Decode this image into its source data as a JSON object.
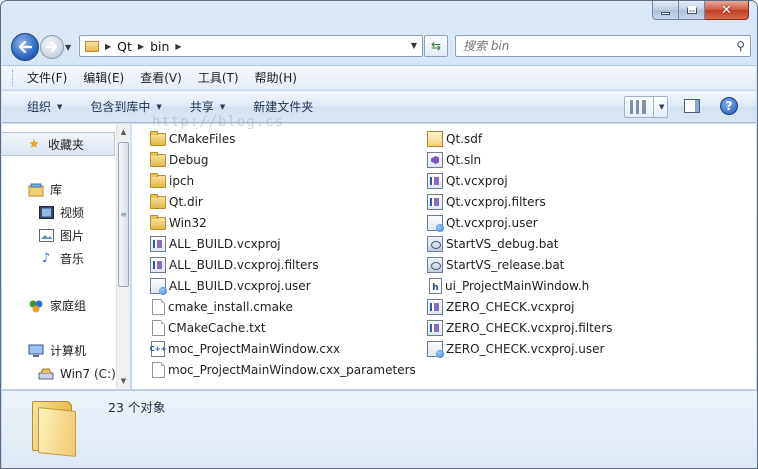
{
  "window": {
    "caption_buttons": {
      "minimize": "minimize-icon",
      "maximize": "maximize-icon",
      "close": "close-icon"
    }
  },
  "address": {
    "crumbs": [
      "Qt",
      "bin"
    ],
    "search_placeholder": "搜索 bin"
  },
  "menu": {
    "items": [
      "文件(F)",
      "编辑(E)",
      "查看(V)",
      "工具(T)",
      "帮助(H)"
    ]
  },
  "commands": {
    "organize": "组织",
    "include_in_library": "包含到库中",
    "share": "共享",
    "new_folder": "新建文件夹"
  },
  "nav": {
    "favorites": "收藏夹",
    "libraries": "库",
    "videos": "视频",
    "pictures": "图片",
    "music": "音乐",
    "homegroup": "家庭组",
    "computer": "计算机",
    "drive": "Win7 (C:)"
  },
  "files": {
    "col1": [
      {
        "name": "CMakeFiles",
        "icon": "folder"
      },
      {
        "name": "Debug",
        "icon": "folder"
      },
      {
        "name": "ipch",
        "icon": "folder"
      },
      {
        "name": "Qt.dir",
        "icon": "folder"
      },
      {
        "name": "Win32",
        "icon": "folder"
      },
      {
        "name": "ALL_BUILD.vcxproj",
        "icon": "vs"
      },
      {
        "name": "ALL_BUILD.vcxproj.filters",
        "icon": "vs"
      },
      {
        "name": "ALL_BUILD.vcxproj.user",
        "icon": "user"
      },
      {
        "name": "cmake_install.cmake",
        "icon": "doc"
      },
      {
        "name": "CMakeCache.txt",
        "icon": "doc"
      },
      {
        "name": "moc_ProjectMainWindow.cxx",
        "icon": "cpp"
      },
      {
        "name": "moc_ProjectMainWindow.cxx_parameters",
        "icon": "doc"
      }
    ],
    "col2": [
      {
        "name": "Qt.sdf",
        "icon": "sdf"
      },
      {
        "name": "Qt.sln",
        "icon": "sln"
      },
      {
        "name": "Qt.vcxproj",
        "icon": "vs"
      },
      {
        "name": "Qt.vcxproj.filters",
        "icon": "vs"
      },
      {
        "name": "Qt.vcxproj.user",
        "icon": "user"
      },
      {
        "name": "StartVS_debug.bat",
        "icon": "bat"
      },
      {
        "name": "StartVS_release.bat",
        "icon": "bat"
      },
      {
        "name": "ui_ProjectMainWindow.h",
        "icon": "h"
      },
      {
        "name": "ZERO_CHECK.vcxproj",
        "icon": "vs"
      },
      {
        "name": "ZERO_CHECK.vcxproj.filters",
        "icon": "vs"
      },
      {
        "name": "ZERO_CHECK.vcxproj.user",
        "icon": "user"
      }
    ]
  },
  "watermark": "http://blog.cs",
  "details": {
    "count": "23 个对象"
  }
}
